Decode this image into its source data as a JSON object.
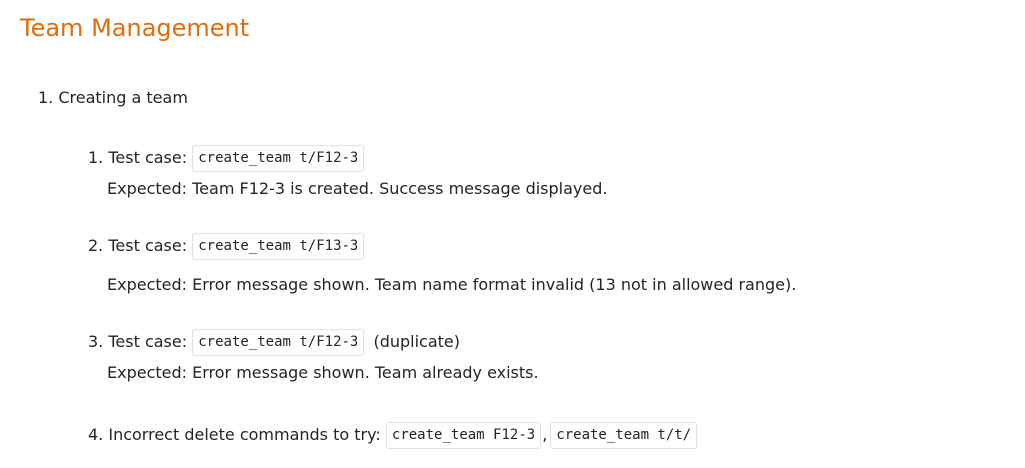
{
  "page_title": "Team Management",
  "section": {
    "number": "1.",
    "label": "Creating a team"
  },
  "items": [
    {
      "number": "1.",
      "prefix": "Test case:",
      "code": "create_team t/F12-3",
      "suffix": "",
      "expected": "Expected: Team F12-3 is created. Success message displayed."
    },
    {
      "number": "2.",
      "prefix": "Test case:",
      "code": "create_team t/F13-3",
      "suffix": "",
      "expected": "Expected: Error message shown. Team name format invalid (13 not in allowed range)."
    },
    {
      "number": "3.",
      "prefix": "Test case:",
      "code": "create_team t/F12-3",
      "suffix": "(duplicate)",
      "expected": "Expected: Error message shown. Team already exists."
    },
    {
      "number": "4.",
      "prefix": "Incorrect delete commands to try:",
      "code": "create_team F12-3",
      "separator": ",",
      "code2": "create_team t/t/"
    }
  ]
}
